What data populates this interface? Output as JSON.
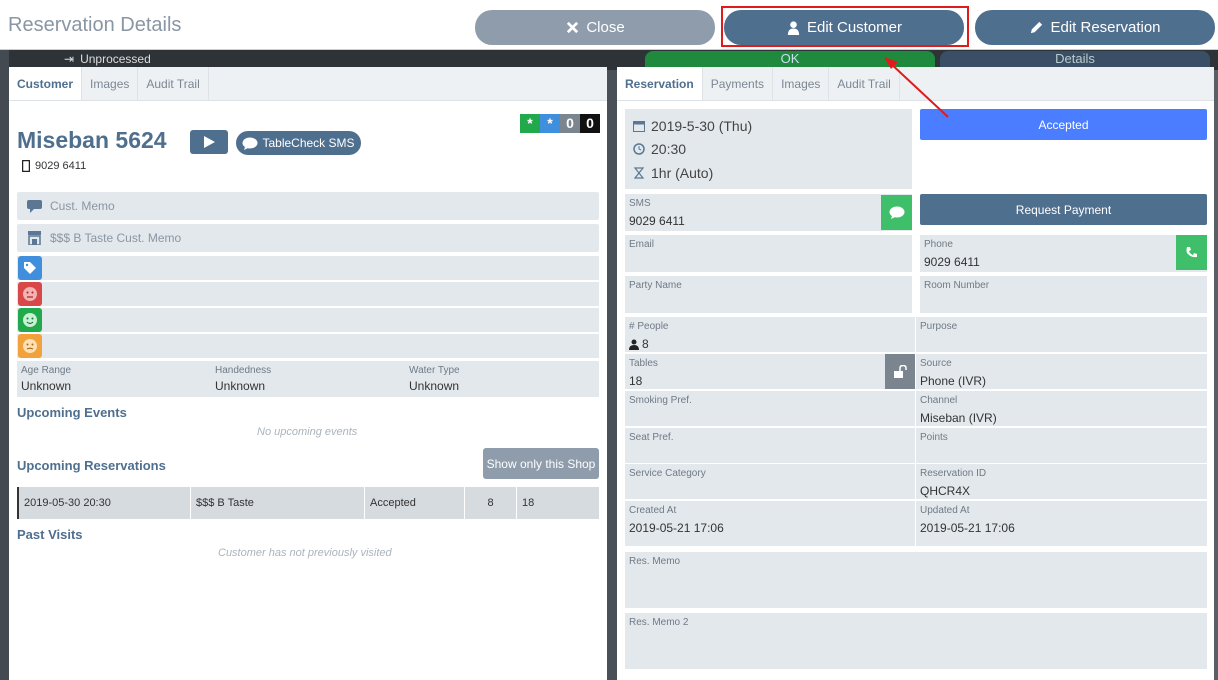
{
  "header": {
    "title": "Reservation Details",
    "close_label": "Close",
    "edit_customer_label": "Edit Customer",
    "edit_reservation_label": "Edit Reservation"
  },
  "background": {
    "unprocessed": "Unprocessed",
    "ok": "OK",
    "details": "Details"
  },
  "customer_panel": {
    "tabs": [
      "Customer",
      "Images",
      "Audit Trail"
    ],
    "name": "Miseban 5624",
    "sms_button": "TableCheck SMS",
    "phone": "9029 6411",
    "badges": [
      "*",
      "*",
      "0",
      "0"
    ],
    "cust_memo_placeholder": "Cust. Memo",
    "shop_memo_placeholder": "$$$ B Taste Cust. Memo",
    "attributes": [
      {
        "label": "Age Range",
        "value": "Unknown"
      },
      {
        "label": "Handedness",
        "value": "Unknown"
      },
      {
        "label": "Water Type",
        "value": "Unknown"
      }
    ],
    "upcoming_events_title": "Upcoming Events",
    "no_events": "No upcoming events",
    "upcoming_reservations_title": "Upcoming Reservations",
    "show_only_shop": "Show only this Shop",
    "reservations": [
      {
        "datetime": "2019-05-30 20:30",
        "shop": "$$$ B Taste",
        "status": "Accepted",
        "people": "8",
        "table": "18"
      }
    ],
    "past_visits_title": "Past Visits",
    "no_visits": "Customer has not previously visited"
  },
  "reservation_panel": {
    "tabs": [
      "Reservation",
      "Payments",
      "Images",
      "Audit Trail"
    ],
    "date": "2019-5-30 (Thu)",
    "time": "20:30",
    "duration": "1hr (Auto)",
    "status_button": "Accepted",
    "request_payment": "Request Payment",
    "fields": {
      "sms": {
        "label": "SMS",
        "value": "9029 6411"
      },
      "email": {
        "label": "Email",
        "value": ""
      },
      "phone": {
        "label": "Phone",
        "value": "9029 6411"
      },
      "party_name": {
        "label": "Party Name",
        "value": ""
      },
      "room_number": {
        "label": "Room Number",
        "value": ""
      },
      "people": {
        "label": "# People",
        "value": "8"
      },
      "purpose": {
        "label": "Purpose",
        "value": ""
      },
      "tables": {
        "label": "Tables",
        "value": "18"
      },
      "source": {
        "label": "Source",
        "value": "Phone (IVR)"
      },
      "smoking": {
        "label": "Smoking Pref.",
        "value": ""
      },
      "channel": {
        "label": "Channel",
        "value": "Miseban (IVR)"
      },
      "seat": {
        "label": "Seat Pref.",
        "value": ""
      },
      "points": {
        "label": "Points",
        "value": ""
      },
      "service_category": {
        "label": "Service Category",
        "value": ""
      },
      "reservation_id": {
        "label": "Reservation ID",
        "value": "QHCR4X"
      },
      "created_at": {
        "label": "Created At",
        "value": "2019-05-21 17:06"
      },
      "updated_at": {
        "label": "Updated At",
        "value": "2019-05-21 17:06"
      },
      "res_memo": {
        "label": "Res. Memo",
        "value": ""
      },
      "res_memo2": {
        "label": "Res. Memo 2",
        "value": ""
      }
    }
  },
  "colors": {
    "accent": "#4f6f8f",
    "accepted": "#4a7dff",
    "green": "#3fbf6a",
    "highlight": "#e01b1b"
  }
}
